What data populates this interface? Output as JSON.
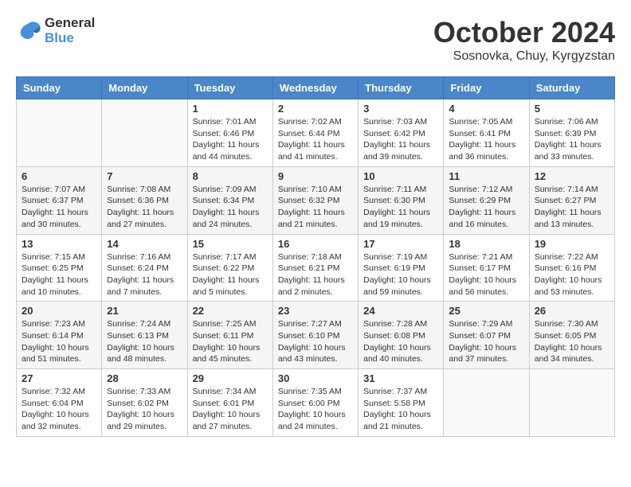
{
  "header": {
    "logo_line1": "General",
    "logo_line2": "Blue",
    "month": "October 2024",
    "location": "Sosnovka, Chuy, Kyrgyzstan"
  },
  "days_of_week": [
    "Sunday",
    "Monday",
    "Tuesday",
    "Wednesday",
    "Thursday",
    "Friday",
    "Saturday"
  ],
  "weeks": [
    [
      {
        "day": "",
        "info": ""
      },
      {
        "day": "",
        "info": ""
      },
      {
        "day": "1",
        "info": "Sunrise: 7:01 AM\nSunset: 6:46 PM\nDaylight: 11 hours and 44 minutes."
      },
      {
        "day": "2",
        "info": "Sunrise: 7:02 AM\nSunset: 6:44 PM\nDaylight: 11 hours and 41 minutes."
      },
      {
        "day": "3",
        "info": "Sunrise: 7:03 AM\nSunset: 6:42 PM\nDaylight: 11 hours and 39 minutes."
      },
      {
        "day": "4",
        "info": "Sunrise: 7:05 AM\nSunset: 6:41 PM\nDaylight: 11 hours and 36 minutes."
      },
      {
        "day": "5",
        "info": "Sunrise: 7:06 AM\nSunset: 6:39 PM\nDaylight: 11 hours and 33 minutes."
      }
    ],
    [
      {
        "day": "6",
        "info": "Sunrise: 7:07 AM\nSunset: 6:37 PM\nDaylight: 11 hours and 30 minutes."
      },
      {
        "day": "7",
        "info": "Sunrise: 7:08 AM\nSunset: 6:36 PM\nDaylight: 11 hours and 27 minutes."
      },
      {
        "day": "8",
        "info": "Sunrise: 7:09 AM\nSunset: 6:34 PM\nDaylight: 11 hours and 24 minutes."
      },
      {
        "day": "9",
        "info": "Sunrise: 7:10 AM\nSunset: 6:32 PM\nDaylight: 11 hours and 21 minutes."
      },
      {
        "day": "10",
        "info": "Sunrise: 7:11 AM\nSunset: 6:30 PM\nDaylight: 11 hours and 19 minutes."
      },
      {
        "day": "11",
        "info": "Sunrise: 7:12 AM\nSunset: 6:29 PM\nDaylight: 11 hours and 16 minutes."
      },
      {
        "day": "12",
        "info": "Sunrise: 7:14 AM\nSunset: 6:27 PM\nDaylight: 11 hours and 13 minutes."
      }
    ],
    [
      {
        "day": "13",
        "info": "Sunrise: 7:15 AM\nSunset: 6:25 PM\nDaylight: 11 hours and 10 minutes."
      },
      {
        "day": "14",
        "info": "Sunrise: 7:16 AM\nSunset: 6:24 PM\nDaylight: 11 hours and 7 minutes."
      },
      {
        "day": "15",
        "info": "Sunrise: 7:17 AM\nSunset: 6:22 PM\nDaylight: 11 hours and 5 minutes."
      },
      {
        "day": "16",
        "info": "Sunrise: 7:18 AM\nSunset: 6:21 PM\nDaylight: 11 hours and 2 minutes."
      },
      {
        "day": "17",
        "info": "Sunrise: 7:19 AM\nSunset: 6:19 PM\nDaylight: 10 hours and 59 minutes."
      },
      {
        "day": "18",
        "info": "Sunrise: 7:21 AM\nSunset: 6:17 PM\nDaylight: 10 hours and 56 minutes."
      },
      {
        "day": "19",
        "info": "Sunrise: 7:22 AM\nSunset: 6:16 PM\nDaylight: 10 hours and 53 minutes."
      }
    ],
    [
      {
        "day": "20",
        "info": "Sunrise: 7:23 AM\nSunset: 6:14 PM\nDaylight: 10 hours and 51 minutes."
      },
      {
        "day": "21",
        "info": "Sunrise: 7:24 AM\nSunset: 6:13 PM\nDaylight: 10 hours and 48 minutes."
      },
      {
        "day": "22",
        "info": "Sunrise: 7:25 AM\nSunset: 6:11 PM\nDaylight: 10 hours and 45 minutes."
      },
      {
        "day": "23",
        "info": "Sunrise: 7:27 AM\nSunset: 6:10 PM\nDaylight: 10 hours and 43 minutes."
      },
      {
        "day": "24",
        "info": "Sunrise: 7:28 AM\nSunset: 6:08 PM\nDaylight: 10 hours and 40 minutes."
      },
      {
        "day": "25",
        "info": "Sunrise: 7:29 AM\nSunset: 6:07 PM\nDaylight: 10 hours and 37 minutes."
      },
      {
        "day": "26",
        "info": "Sunrise: 7:30 AM\nSunset: 6:05 PM\nDaylight: 10 hours and 34 minutes."
      }
    ],
    [
      {
        "day": "27",
        "info": "Sunrise: 7:32 AM\nSunset: 6:04 PM\nDaylight: 10 hours and 32 minutes."
      },
      {
        "day": "28",
        "info": "Sunrise: 7:33 AM\nSunset: 6:02 PM\nDaylight: 10 hours and 29 minutes."
      },
      {
        "day": "29",
        "info": "Sunrise: 7:34 AM\nSunset: 6:01 PM\nDaylight: 10 hours and 27 minutes."
      },
      {
        "day": "30",
        "info": "Sunrise: 7:35 AM\nSunset: 6:00 PM\nDaylight: 10 hours and 24 minutes."
      },
      {
        "day": "31",
        "info": "Sunrise: 7:37 AM\nSunset: 5:58 PM\nDaylight: 10 hours and 21 minutes."
      },
      {
        "day": "",
        "info": ""
      },
      {
        "day": "",
        "info": ""
      }
    ]
  ]
}
